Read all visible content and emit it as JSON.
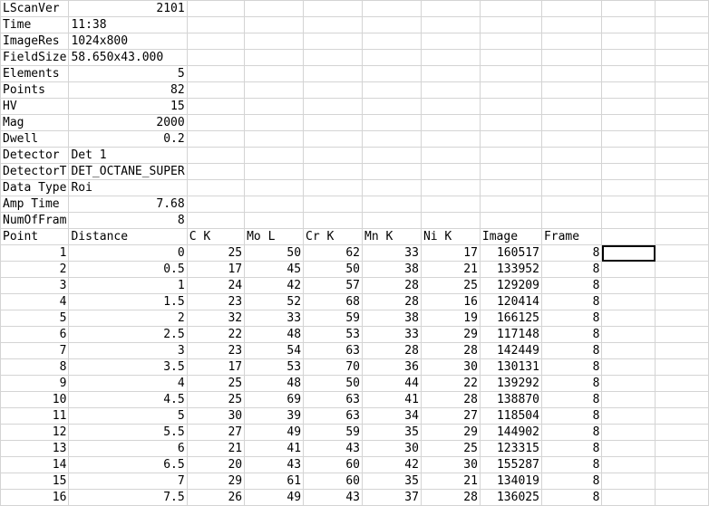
{
  "header_rows": [
    {
      "key": "LScanVer",
      "value": "2101",
      "align": "num"
    },
    {
      "key": "Time",
      "value": "11:38",
      "align": "txt"
    },
    {
      "key": "ImageRes",
      "value": "1024x800",
      "align": "txt"
    },
    {
      "key": "FieldSize",
      "value": "58.650x43.000",
      "align": "txt"
    },
    {
      "key": "Elements",
      "value": "5",
      "align": "num"
    },
    {
      "key": "Points",
      "value": "82",
      "align": "num"
    },
    {
      "key": "HV",
      "value": "15",
      "align": "num"
    },
    {
      "key": "Mag",
      "value": "2000",
      "align": "num"
    },
    {
      "key": "Dwell",
      "value": "0.2",
      "align": "num"
    },
    {
      "key": "Detector",
      "value": "Det 1",
      "align": "txt"
    },
    {
      "key": "DetectorT",
      "value": "DET_OCTANE_SUPER",
      "align": "txt"
    },
    {
      "key": "Data Type",
      "value": "Roi",
      "align": "txt"
    },
    {
      "key": "Amp Time",
      "value": "7.68",
      "align": "num"
    },
    {
      "key": "NumOfFram",
      "value": "8",
      "align": "num"
    }
  ],
  "column_headers": [
    "Point",
    "Distance",
    "C K",
    "Mo L",
    "Cr K",
    "Mn K",
    "Ni K",
    "Image",
    "Frame"
  ],
  "data_rows": [
    [
      "1",
      "0",
      "25",
      "50",
      "62",
      "33",
      "17",
      "160517",
      "8"
    ],
    [
      "2",
      "0.5",
      "17",
      "45",
      "50",
      "38",
      "21",
      "133952",
      "8"
    ],
    [
      "3",
      "1",
      "24",
      "42",
      "57",
      "28",
      "25",
      "129209",
      "8"
    ],
    [
      "4",
      "1.5",
      "23",
      "52",
      "68",
      "28",
      "16",
      "120414",
      "8"
    ],
    [
      "5",
      "2",
      "32",
      "33",
      "59",
      "38",
      "19",
      "166125",
      "8"
    ],
    [
      "6",
      "2.5",
      "22",
      "48",
      "53",
      "33",
      "29",
      "117148",
      "8"
    ],
    [
      "7",
      "3",
      "23",
      "54",
      "63",
      "28",
      "28",
      "142449",
      "8"
    ],
    [
      "8",
      "3.5",
      "17",
      "53",
      "70",
      "36",
      "30",
      "130131",
      "8"
    ],
    [
      "9",
      "4",
      "25",
      "48",
      "50",
      "44",
      "22",
      "139292",
      "8"
    ],
    [
      "10",
      "4.5",
      "25",
      "69",
      "63",
      "41",
      "28",
      "138870",
      "8"
    ],
    [
      "11",
      "5",
      "30",
      "39",
      "63",
      "34",
      "27",
      "118504",
      "8"
    ],
    [
      "12",
      "5.5",
      "27",
      "49",
      "59",
      "35",
      "29",
      "144902",
      "8"
    ],
    [
      "13",
      "6",
      "21",
      "41",
      "43",
      "30",
      "25",
      "123315",
      "8"
    ],
    [
      "14",
      "6.5",
      "20",
      "43",
      "60",
      "42",
      "30",
      "155287",
      "8"
    ],
    [
      "15",
      "7",
      "29",
      "61",
      "60",
      "35",
      "21",
      "134019",
      "8"
    ],
    [
      "16",
      "7.5",
      "26",
      "49",
      "43",
      "37",
      "28",
      "136025",
      "8"
    ]
  ]
}
